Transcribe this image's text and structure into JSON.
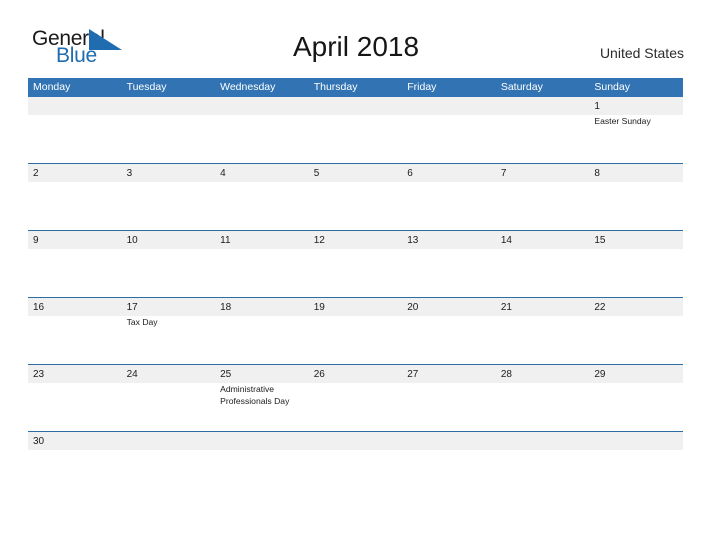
{
  "brand": {
    "name_part1": "General",
    "name_part2": "Blue",
    "triangle_icon": "triangle-flag-icon",
    "accent_color": "#1f6cb0"
  },
  "header": {
    "title": "April 2018",
    "country": "United States"
  },
  "theme": {
    "header_blue": "#3274b3",
    "row_border_blue": "#2e6da4",
    "band_gray": "#f0f0f0",
    "text_dark": "#1c1c1c"
  },
  "calendar": {
    "month": "April",
    "year": "2018",
    "weekday_headers": [
      "Monday",
      "Tuesday",
      "Wednesday",
      "Thursday",
      "Friday",
      "Saturday",
      "Sunday"
    ],
    "weeks": [
      {
        "short": false,
        "days": [
          {
            "num": "",
            "event": ""
          },
          {
            "num": "",
            "event": ""
          },
          {
            "num": "",
            "event": ""
          },
          {
            "num": "",
            "event": ""
          },
          {
            "num": "",
            "event": ""
          },
          {
            "num": "",
            "event": ""
          },
          {
            "num": "1",
            "event": "Easter Sunday"
          }
        ]
      },
      {
        "short": false,
        "days": [
          {
            "num": "2",
            "event": ""
          },
          {
            "num": "3",
            "event": ""
          },
          {
            "num": "4",
            "event": ""
          },
          {
            "num": "5",
            "event": ""
          },
          {
            "num": "6",
            "event": ""
          },
          {
            "num": "7",
            "event": ""
          },
          {
            "num": "8",
            "event": ""
          }
        ]
      },
      {
        "short": false,
        "days": [
          {
            "num": "9",
            "event": ""
          },
          {
            "num": "10",
            "event": ""
          },
          {
            "num": "11",
            "event": ""
          },
          {
            "num": "12",
            "event": ""
          },
          {
            "num": "13",
            "event": ""
          },
          {
            "num": "14",
            "event": ""
          },
          {
            "num": "15",
            "event": ""
          }
        ]
      },
      {
        "short": false,
        "days": [
          {
            "num": "16",
            "event": ""
          },
          {
            "num": "17",
            "event": "Tax Day"
          },
          {
            "num": "18",
            "event": ""
          },
          {
            "num": "19",
            "event": ""
          },
          {
            "num": "20",
            "event": ""
          },
          {
            "num": "21",
            "event": ""
          },
          {
            "num": "22",
            "event": ""
          }
        ]
      },
      {
        "short": false,
        "days": [
          {
            "num": "23",
            "event": ""
          },
          {
            "num": "24",
            "event": ""
          },
          {
            "num": "25",
            "event": "Administrative Professionals Day"
          },
          {
            "num": "26",
            "event": ""
          },
          {
            "num": "27",
            "event": ""
          },
          {
            "num": "28",
            "event": ""
          },
          {
            "num": "29",
            "event": ""
          }
        ]
      },
      {
        "short": true,
        "days": [
          {
            "num": "30",
            "event": ""
          },
          {
            "num": "",
            "event": ""
          },
          {
            "num": "",
            "event": ""
          },
          {
            "num": "",
            "event": ""
          },
          {
            "num": "",
            "event": ""
          },
          {
            "num": "",
            "event": ""
          },
          {
            "num": "",
            "event": ""
          }
        ]
      }
    ]
  }
}
